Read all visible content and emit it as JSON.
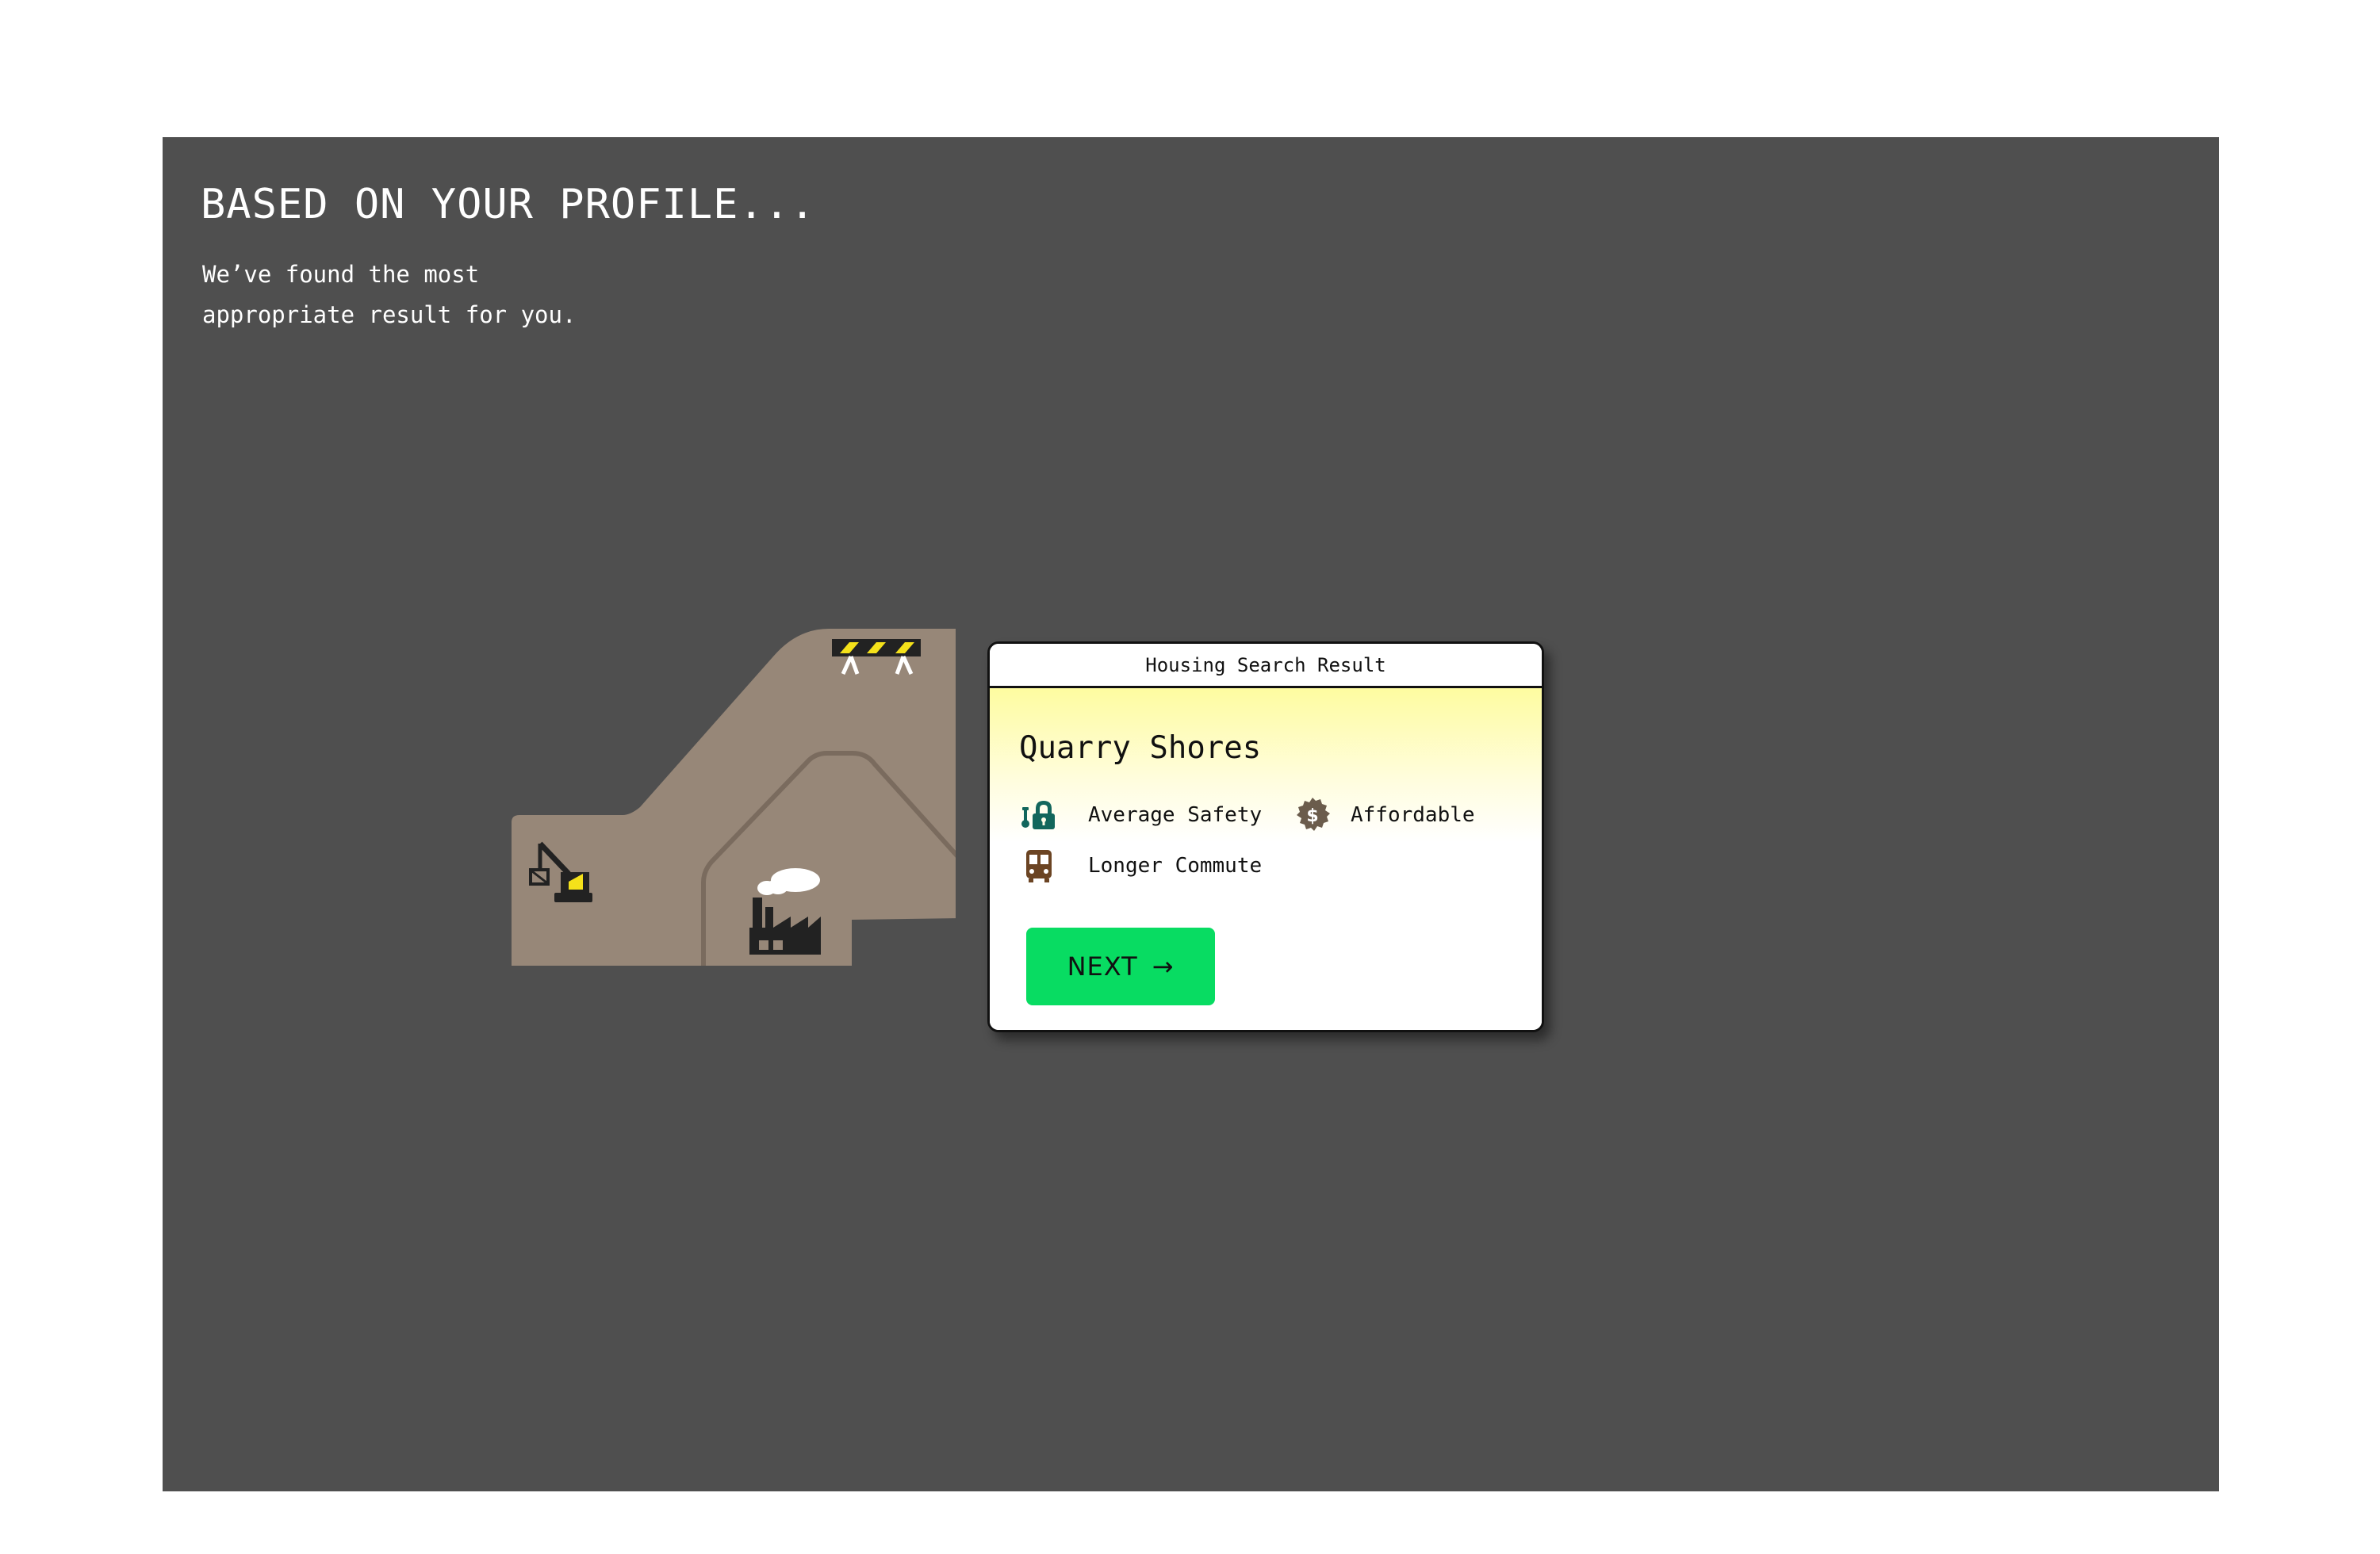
{
  "header": {
    "title": "BASED ON YOUR PROFILE...",
    "subtitle_line1": "We’ve found the most",
    "subtitle_line2": "appropriate result for you."
  },
  "map": {
    "icons": [
      "excavator-icon",
      "factory-icon",
      "road-barrier-icon"
    ],
    "colors": {
      "land": "#978778",
      "road": "#7a6b5e",
      "background": "#4f4f4f"
    }
  },
  "card": {
    "window_title": "Housing Search Result",
    "place_name": "Quarry Shores",
    "attributes": [
      {
        "icon": "safety-lock-icon",
        "label": "Average Safety",
        "color": "#12665c"
      },
      {
        "icon": "dollar-badge-icon",
        "label": "Affordable",
        "color": "#6b5c4c"
      },
      {
        "icon": "bus-icon",
        "label": "Longer Commute",
        "color": "#6b4423"
      }
    ],
    "next_button": {
      "label": "NEXT",
      "arrow": "→",
      "color": "#08dc62"
    }
  }
}
